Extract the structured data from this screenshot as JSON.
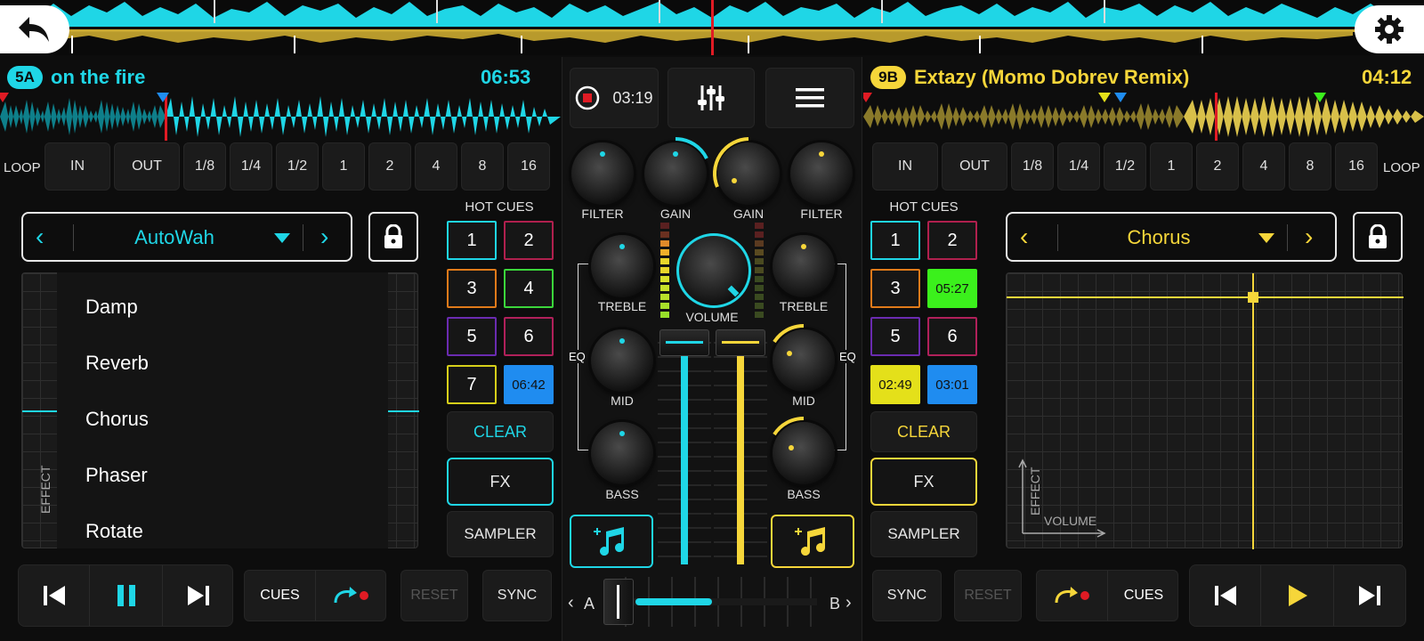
{
  "colors": {
    "deck_a": "#1fd6e6",
    "deck_b": "#f6d63a",
    "record": "#e01b24",
    "cue_green": "#3bf01c",
    "cue_blue": "#1f8cf0",
    "cue_yellow": "#e4e01a"
  },
  "top": {
    "back_icon": "back-arrow-icon",
    "settings_icon": "gear-icon"
  },
  "deck_a": {
    "key": "5A",
    "title": "on the fire",
    "time": "06:53",
    "loop_label": "LOOP",
    "loop_in": "IN",
    "loop_out": "OUT",
    "loop_sizes": [
      "1/8",
      "1/4",
      "1/2",
      "1",
      "2",
      "4",
      "8",
      "16"
    ],
    "fx": {
      "selected": "AutoWah",
      "axis_label": "EFFECT",
      "list": [
        "Damp",
        "Reverb",
        "Chorus",
        "Phaser",
        "Rotate"
      ]
    },
    "hot_cues_label": "HOT CUES",
    "cues": [
      "1",
      "2",
      "3",
      "4",
      "5",
      "6",
      "7",
      "06:42"
    ],
    "clear": "CLEAR",
    "fx_btn": "FX",
    "sampler": "SAMPLER",
    "cues_btn": "CUES",
    "reset": "RESET",
    "sync": "SYNC"
  },
  "deck_b": {
    "key": "9B",
    "title": "Extazy (Momo Dobrev Remix)",
    "time": "04:12",
    "loop_label": "LOOP",
    "loop_in": "IN",
    "loop_out": "OUT",
    "loop_sizes": [
      "1/8",
      "1/4",
      "1/2",
      "1",
      "2",
      "4",
      "8",
      "16"
    ],
    "fx": {
      "selected": "Chorus",
      "axis_y": "EFFECT",
      "axis_x": "VOLUME"
    },
    "hot_cues_label": "HOT CUES",
    "cues": [
      "1",
      "2",
      "3",
      "05:27",
      "5",
      "6",
      "02:49",
      "03:01"
    ],
    "clear": "CLEAR",
    "fx_btn": "FX",
    "sampler": "SAMPLER",
    "cues_btn": "CUES",
    "reset": "RESET",
    "sync": "SYNC"
  },
  "mixer": {
    "rec_time": "03:19",
    "filter": "FILTER",
    "gain": "GAIN",
    "treble": "TREBLE",
    "mid": "MID",
    "bass": "BASS",
    "volume": "VOLUME",
    "eq": "EQ",
    "cross_a": "A",
    "cross_b": "B"
  }
}
